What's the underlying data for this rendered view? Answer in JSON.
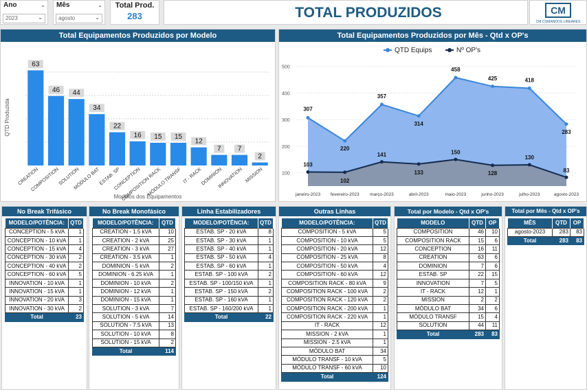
{
  "filters": {
    "ano_label": "Ano",
    "ano_value": "2023",
    "mes_label": "Mês",
    "mes_value": "agosto"
  },
  "kpi": {
    "label": "Total Prod.",
    "value": "283"
  },
  "page_title": "TOTAL PRODUZIDOS",
  "logo": {
    "text": "CM",
    "caption": "CM COMANDOS LINEARES"
  },
  "colors": {
    "header": "#1e5b84",
    "bar": "#2a8ae8",
    "area_light": "#6fa3ec",
    "line_qtd": "#3a86d8",
    "line_ops": "#142d50"
  },
  "chart_data": [
    {
      "type": "bar",
      "title": "Total Equipamentos Produzidos por Modelo",
      "xlabel": "Modelos dos Equipamentos",
      "ylabel": "QTD Produzida",
      "categories": [
        "CREATION",
        "COMPOSITION",
        "SOLUTION",
        "MÓDULO BAT",
        "ESTAB. SP",
        "CONCEPTION",
        "COMPOSITION RACK",
        "MÓDULO TRANSF",
        "IT - RACK",
        "DOMINION",
        "INNOVATION",
        "MISSION"
      ],
      "values": [
        63,
        46,
        44,
        34,
        22,
        16,
        15,
        15,
        12,
        7,
        7,
        2
      ],
      "ylim": [
        0,
        70
      ],
      "grid": true
    },
    {
      "type": "area",
      "title": "Total Equipamentos Produzidos por Mês - Qtd x OP's",
      "categories": [
        "janeiro-2023",
        "fevereiro-2023",
        "março-2023",
        "abril-2023",
        "maio-2023",
        "junho-2023",
        "julho-2023",
        "agosto-2023"
      ],
      "yticks": [
        "100",
        "200",
        "300",
        "400",
        "500"
      ],
      "ylim": [
        50,
        520
      ],
      "legend_position": "top",
      "grid": true,
      "series": [
        {
          "name": "QTD Equips",
          "values": [
            307,
            220,
            357,
            314,
            458,
            425,
            418,
            283
          ]
        },
        {
          "name": "Nº OP's",
          "values": [
            103,
            102,
            141,
            133,
            150,
            128,
            130,
            83
          ]
        }
      ]
    }
  ],
  "tables": [
    {
      "title": "No Break Trifásico",
      "headers": [
        "MODELO/POTÊNCIA:",
        "QTD"
      ],
      "rows": [
        [
          "CONCEPTION - 5 kVA",
          "1"
        ],
        [
          "CONCEPTION - 10 kVA",
          "1"
        ],
        [
          "CONCEPTION - 15 kVA",
          "4"
        ],
        [
          "CONCEPTION - 30 kVA",
          "2"
        ],
        [
          "CONCEPTION - 40 kVA",
          "2"
        ],
        [
          "CONCEPTION - 60 kVA",
          "5"
        ],
        [
          "INNOVATION - 10 kVA",
          "1"
        ],
        [
          "INNOVATION - 15 kVA",
          "1"
        ],
        [
          "INNOVATION - 20 kVA",
          "3"
        ],
        [
          "INNOVATION - 30 kVA",
          "2"
        ]
      ],
      "total": [
        "Total",
        "23"
      ]
    },
    {
      "title": "No Break Monofásico",
      "headers": [
        "MODELO/POTÊNCIA:",
        "QTD"
      ],
      "rows": [
        [
          "CREATION - 1.5 kVA",
          "10"
        ],
        [
          "CREATION - 2 kVA",
          "25"
        ],
        [
          "CREATION - 3 kVA",
          "27"
        ],
        [
          "CREATION - 3.5 kVA",
          "1"
        ],
        [
          "DOMINION - 5 kVA",
          "2"
        ],
        [
          "DOMINION - 6.25 kVA",
          "1"
        ],
        [
          "DOMINION - 10 kVA",
          "2"
        ],
        [
          "DOMINION - 12 kVA",
          "1"
        ],
        [
          "DOMINION - 15 kVA",
          "1"
        ],
        [
          "SOLUTION - 3 kVA",
          "7"
        ],
        [
          "SOLUTION - 5 kVA",
          "14"
        ],
        [
          "SOLUTION - 7.5 kVA",
          "13"
        ],
        [
          "SOLUTION - 10 kVA",
          "8"
        ],
        [
          "SOLUTION - 15 kVA",
          "2"
        ]
      ],
      "total": [
        "Total",
        "114"
      ]
    },
    {
      "title": "Linha Estabilizadores",
      "headers": [
        "MODELO/POTÊNCIA:",
        "QTD"
      ],
      "rows": [
        [
          "ESTAB. SP - 20 kVA",
          "8"
        ],
        [
          "ESTAB. SP - 30 kVA",
          "1"
        ],
        [
          "ESTAB. SP - 40 kVA",
          "1"
        ],
        [
          "ESTAB. SP - 50 kVA",
          "4"
        ],
        [
          "ESTAB. SP - 60 kVA",
          "1"
        ],
        [
          "ESTAB. SP - 100 kVA",
          "2"
        ],
        [
          "ESTAB. SP - 100/150 kVA",
          "1"
        ],
        [
          "ESTAB. SP - 150 kVA",
          "2"
        ],
        [
          "ESTAB. SP - 160 kVA",
          "1"
        ],
        [
          "ESTAB. SP - 160/200 kVA",
          "1"
        ]
      ],
      "total": [
        "Total",
        "22"
      ]
    },
    {
      "title": "Outras Linhas",
      "headers": [
        "MODELO/POTÊNCIA:",
        "QTD"
      ],
      "rows": [
        [
          "COMPOSITION - 5 kVA",
          "5"
        ],
        [
          "COMPOSITION - 10 kVA",
          "5"
        ],
        [
          "COMPOSITION - 20 kVA",
          "12"
        ],
        [
          "COMPOSITION - 25 kVA",
          "8"
        ],
        [
          "COMPOSITION - 50 kVA",
          "4"
        ],
        [
          "COMPOSITION - 60 kVA",
          "12"
        ],
        [
          "COMPOSITION RACK - 80 kVA",
          "9"
        ],
        [
          "COMPOSITION RACK - 100 kVA",
          "2"
        ],
        [
          "COMPOSITION RACK - 120 kVA",
          "2"
        ],
        [
          "COMPOSITION RACK - 200 kVA",
          "1"
        ],
        [
          "COMPOSITION RACK - 220 kVA",
          "1"
        ],
        [
          "IT - RACK",
          "12"
        ],
        [
          "MISSION - 2 kVA",
          "1"
        ],
        [
          "MISSION - 2.5 kVA",
          "1"
        ],
        [
          "MÓDULO BAT",
          "34"
        ],
        [
          "MÓDULO TRANSF - 10 kVA",
          "5"
        ],
        [
          "MÓDULO TRANSF - 60 kVA",
          "10"
        ]
      ],
      "total": [
        "Total",
        "124"
      ]
    },
    {
      "title": "Total por Modelo - Qtd x OP's",
      "headers": [
        "MODELO",
        "QTD",
        "OP"
      ],
      "rows": [
        [
          "COMPOSITION",
          "46",
          "10"
        ],
        [
          "COMPOSITION RACK",
          "15",
          "6"
        ],
        [
          "CONCEPTION",
          "16",
          "11"
        ],
        [
          "CREATION",
          "63",
          "6"
        ],
        [
          "DOMINION",
          "7",
          "6"
        ],
        [
          "ESTAB. SP",
          "22",
          "15"
        ],
        [
          "INNOVATION",
          "7",
          "5"
        ],
        [
          "IT - RACK",
          "12",
          "1"
        ],
        [
          "MISSION",
          "2",
          "2"
        ],
        [
          "MÓDULO BAT",
          "34",
          "6"
        ],
        [
          "MÓDULO TRANSF",
          "15",
          "4"
        ],
        [
          "SOLUTION",
          "44",
          "11"
        ]
      ],
      "total": [
        "Total",
        "283",
        "83"
      ]
    },
    {
      "title": "Total por Mês - Qtd x OP's",
      "headers": [
        "MÊS",
        "QTD",
        "OP"
      ],
      "rows": [
        [
          "agosto-2023",
          "283",
          "83"
        ]
      ],
      "total": [
        "Total",
        "283",
        "83"
      ]
    }
  ]
}
